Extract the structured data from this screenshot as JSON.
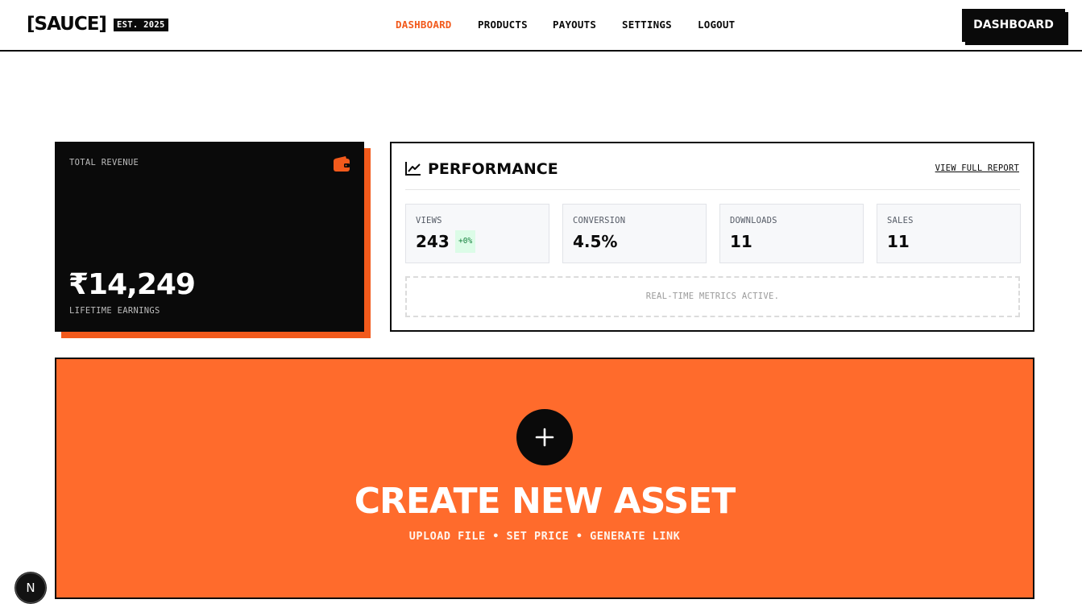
{
  "brand": {
    "logo": "[SAUCE]",
    "est": "EST. 2025"
  },
  "nav": {
    "items": [
      {
        "label": "DASHBOARD",
        "active": true
      },
      {
        "label": "PRODUCTS",
        "active": false
      },
      {
        "label": "PAYOUTS",
        "active": false
      },
      {
        "label": "SETTINGS",
        "active": false
      },
      {
        "label": "LOGOUT",
        "active": false
      }
    ],
    "cta_label": "DASHBOARD"
  },
  "revenue": {
    "label": "TOTAL REVENUE",
    "amount": "₹14,249",
    "sublabel": "LIFETIME EARNINGS",
    "icon": "wallet-icon"
  },
  "performance": {
    "title": "PERFORMANCE",
    "icon": "trending-chart-icon",
    "link": "VIEW FULL REPORT",
    "metrics": [
      {
        "label": "VIEWS",
        "value": "243",
        "badge": "+0%"
      },
      {
        "label": "CONVERSION",
        "value": "4.5%"
      },
      {
        "label": "DOWNLOADS",
        "value": "11"
      },
      {
        "label": "SALES",
        "value": "11"
      }
    ],
    "status": "REAL-TIME METRICS ACTIVE."
  },
  "create": {
    "title": "CREATE NEW ASSET",
    "subtitle": "UPLOAD FILE • SET PRICE • GENERATE LINK",
    "icon": "plus-icon"
  },
  "floating_badge": {
    "label": "N"
  },
  "colors": {
    "accent": "#f25a1c",
    "create_bg": "#ff6b2c",
    "dark": "#0a0a0a",
    "badge_bg": "#dcfce7",
    "badge_fg": "#15803d"
  }
}
